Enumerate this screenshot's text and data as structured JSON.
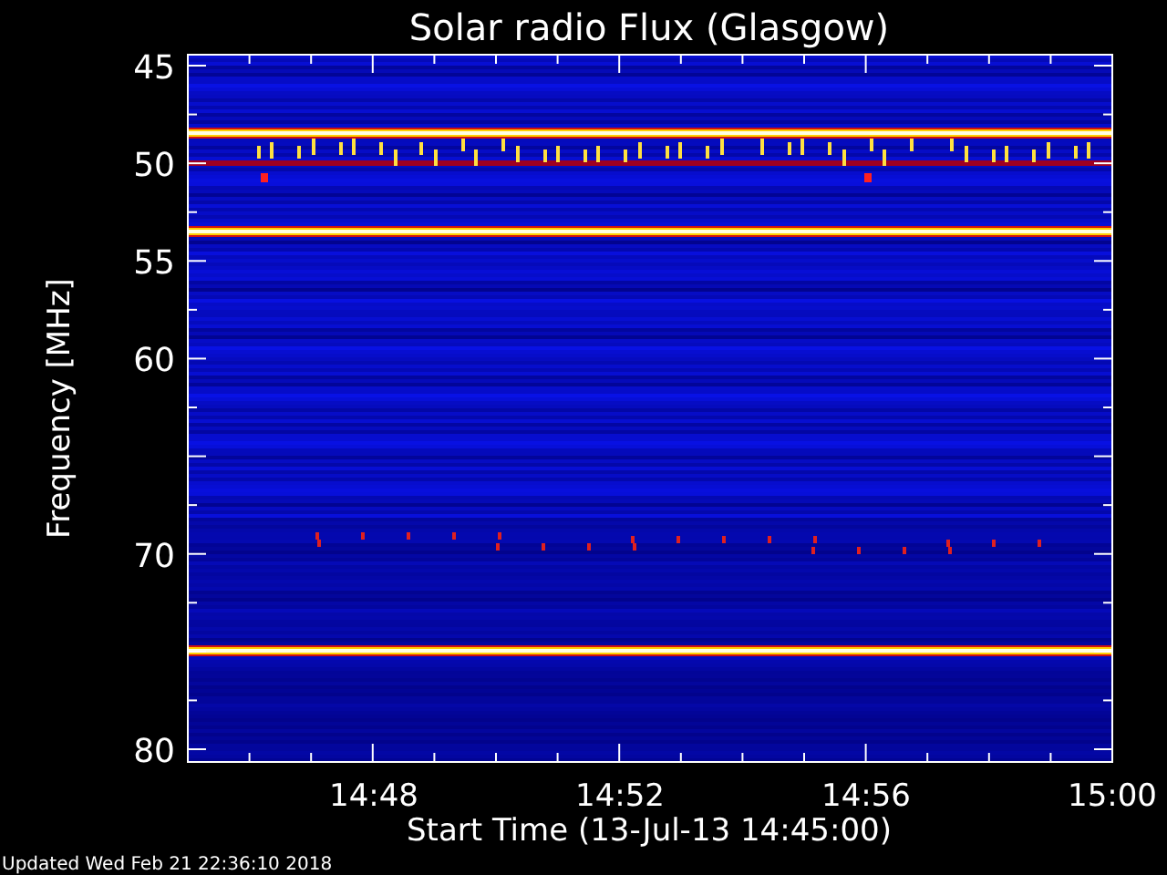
{
  "title": "Solar radio Flux (Glasgow)",
  "y_axis": {
    "label": "Frequency [MHz]",
    "ticks": [
      "45",
      "50",
      "55",
      "60",
      "70",
      "80"
    ]
  },
  "x_axis": {
    "label": "Start Time (13-Jul-13 14:45:00)",
    "ticks": [
      "14:48",
      "14:52",
      "14:56",
      "15:00"
    ]
  },
  "updated": "Updated Wed Feb 21 22:36:10 2018"
}
